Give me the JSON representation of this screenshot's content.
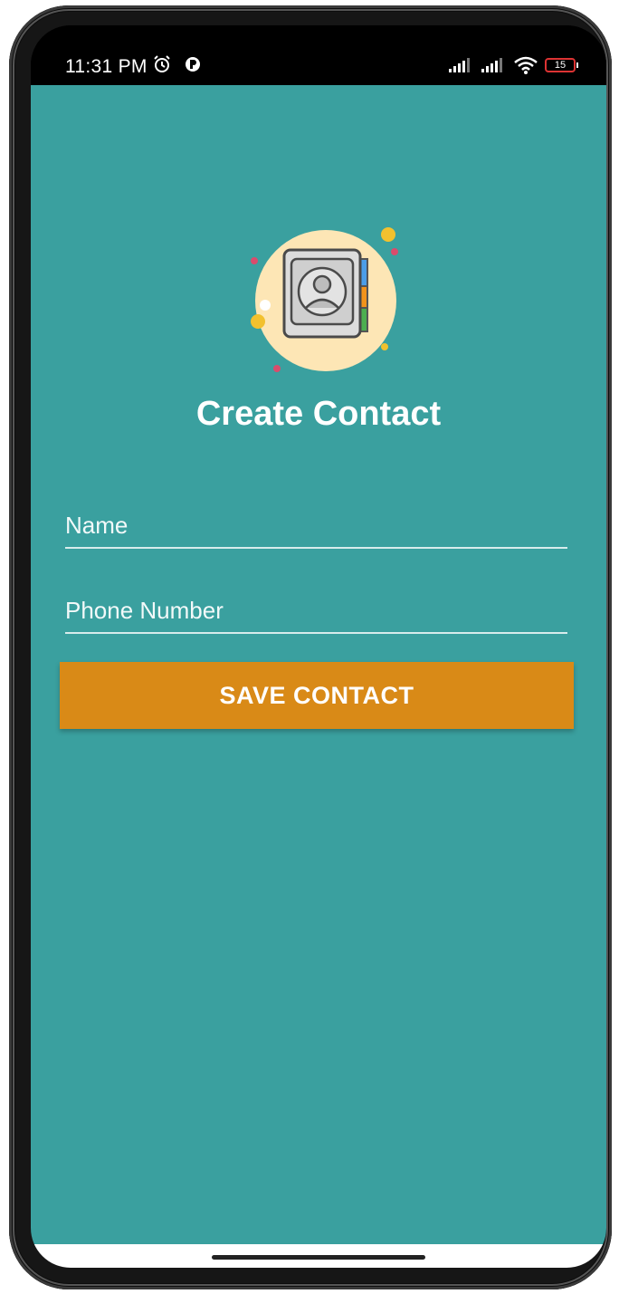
{
  "status_bar": {
    "time": "11:31 PM",
    "battery_level": "15",
    "icons": [
      "alarm-icon",
      "app-notification-icon",
      "signal-icon",
      "signal-icon",
      "wifi-icon",
      "battery-icon"
    ]
  },
  "screen": {
    "title": "Create Contact",
    "name_field": {
      "placeholder": "Name",
      "value": ""
    },
    "phone_field": {
      "placeholder": "Phone Number",
      "value": ""
    },
    "save_button_label": "SAVE CONTACT"
  },
  "colors": {
    "background": "#3aa09f",
    "button": "#d98a17",
    "text": "#ffffff"
  }
}
